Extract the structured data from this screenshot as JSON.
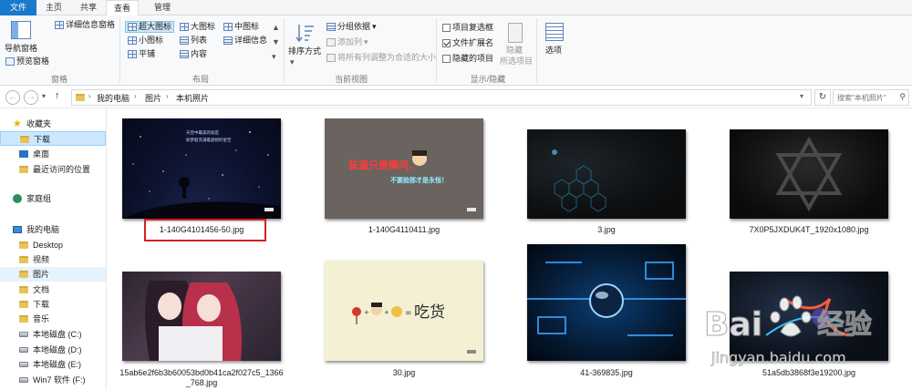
{
  "tabs": {
    "file": "文件",
    "home": "主页",
    "share": "共享",
    "view": "查看",
    "manage": "管理"
  },
  "ribbon": {
    "pane_group": {
      "nav_pane": "导航窗格",
      "preview_pane": "预览窗格",
      "details_pane": "详细信息窗格",
      "label": "窗格"
    },
    "layout_group": {
      "extra_large": "超大图标",
      "large": "大图标",
      "medium": "中图标",
      "small": "小图标",
      "list": "列表",
      "details": "详细信息",
      "tiles": "平铺",
      "content": "内容",
      "label": "布局"
    },
    "view_group": {
      "sort_by": "排序方式",
      "group_by": "分组依据",
      "add_columns": "添加列",
      "size_all_columns": "将所有列调整为合适的大小",
      "label": "当前视图"
    },
    "showhide_group": {
      "item_checkboxes": "项目复选框",
      "item_checkboxes_checked": false,
      "file_extensions": "文件扩展名",
      "file_extensions_checked": true,
      "hidden_items": "隐藏的项目",
      "hidden_items_checked": false,
      "hide_selected": "隐藏",
      "hide_selected_sub": "所选项目",
      "label": "显示/隐藏"
    },
    "options": "选项"
  },
  "address": {
    "crumbs": [
      "我的电脑",
      "图片",
      "本机照片"
    ],
    "search_placeholder": "搜索\"本机照片\""
  },
  "nav": {
    "favorites": "收藏夹",
    "fav_items": [
      "下载",
      "桌面",
      "最近访问的位置"
    ],
    "homegroup": "家庭组",
    "computer": "我的电脑",
    "pc_items": [
      "Desktop",
      "视频",
      "图片",
      "文档",
      "下载",
      "音乐",
      "本地磁盘 (C:)",
      "本地磁盘 (D:)",
      "本地磁盘 (E:)",
      "Win7 软件 (F:)"
    ]
  },
  "files": [
    {
      "name": "1-140G4101456-50.jpg",
      "thumb_text": [
        "天空中最美的就是",
        "如梦般充满着遐想的星空"
      ]
    },
    {
      "name": "1-140G4110411.jpg",
      "thumb_text": [
        "装逼只是瞬间，",
        "不要脸那才是永恒！"
      ]
    },
    {
      "name": "3.jpg"
    },
    {
      "name": "7X0P5JXDUK4T_1920x1080.jpg"
    },
    {
      "name": "15ab6e2f6b3b60053bd0b41ca2f027c5_1366_768.jpg",
      "name_lines": [
        "15ab6e2f6b3b60053bd0b41ca2f027c5_1366",
        "_768.jpg"
      ]
    },
    {
      "name": "30.jpg",
      "thumb_text": [
        "吃货"
      ]
    },
    {
      "name": "41-369835.jpg"
    },
    {
      "name": "51a5db3868f3e19200.jpg"
    }
  ],
  "watermark": {
    "brand": "Bai",
    "brand2": "经验",
    "url": "jingyan.baidu.com"
  },
  "colors": {
    "file_tab": "#1979ca",
    "selection": "#cce8ff",
    "highlight_box": "#d32020"
  }
}
